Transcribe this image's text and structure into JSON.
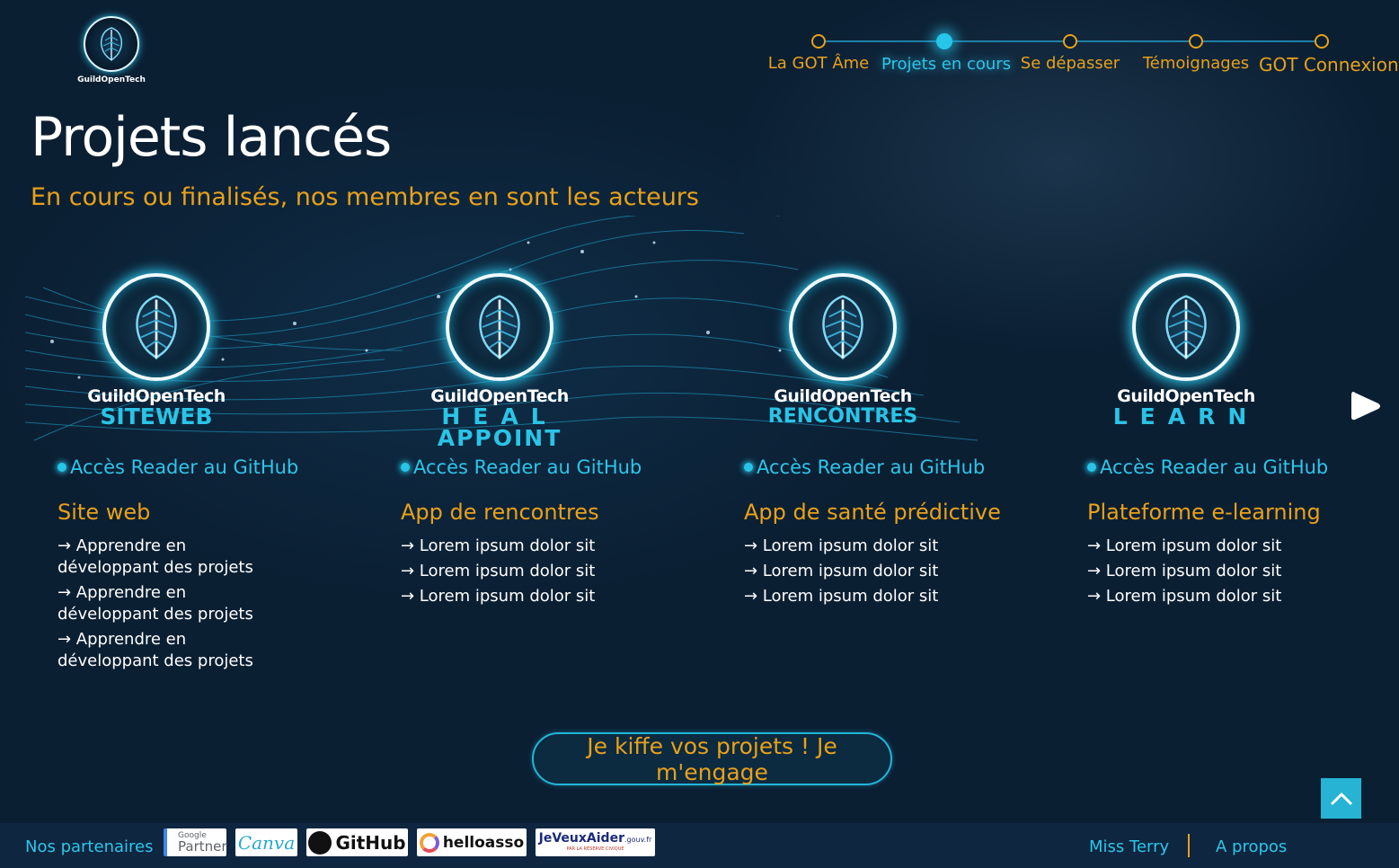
{
  "brand": {
    "logo_text": "GuildOpenTech",
    "logo_icon": "tree-brain-icon"
  },
  "nav": {
    "steps": [
      {
        "label": "La GOT Âme",
        "active": false
      },
      {
        "label": "Projets en cours",
        "active": true
      },
      {
        "label": "Se dépasser",
        "active": false
      },
      {
        "label": "Témoignages",
        "active": false
      },
      {
        "label": "GOT Connexion",
        "active": false
      }
    ]
  },
  "hero": {
    "title": "Projets lancés",
    "subtitle": "En cours ou finalisés, nos membres en sont les acteurs"
  },
  "projects": [
    {
      "brand": "GuildOpenTech",
      "sub_lines": [
        "SITEWEB"
      ],
      "github": "Accès Reader au GitHub",
      "title": "Site web",
      "items": [
        "→ Apprendre en développant des projets",
        "→ Apprendre en développant des projets",
        "→ Apprendre en développant des projets"
      ]
    },
    {
      "brand": "GuildOpenTech",
      "sub_lines": [
        "HEAL",
        "APPOINT"
      ],
      "github": "Accès Reader au GitHub",
      "title": "App de rencontres",
      "items": [
        "→ Lorem ipsum dolor sit",
        "→ Lorem ipsum dolor sit",
        "→ Lorem ipsum dolor sit"
      ]
    },
    {
      "brand": "GuildOpenTech",
      "sub_lines": [
        "RENCONTRES"
      ],
      "github": "Accès Reader au GitHub",
      "title": "App de santé prédictive",
      "items": [
        "→ Lorem ipsum dolor sit",
        "→ Lorem ipsum dolor sit",
        "→ Lorem ipsum dolor sit"
      ]
    },
    {
      "brand": "GuildOpenTech",
      "sub_lines": [
        "LEARN"
      ],
      "github": "Accès Reader au GitHub",
      "title": "Plateforme e-learning",
      "items": [
        "→ Lorem ipsum dolor sit",
        "→ Lorem ipsum dolor sit",
        "→ Lorem ipsum dolor sit"
      ]
    }
  ],
  "carousel": {
    "next_icon": "play-next-icon"
  },
  "cta": {
    "label": "Je kiffe vos projets ! Je m'engage"
  },
  "back_to_top": {
    "icon": "chevron-up-icon"
  },
  "footer": {
    "partners_label": "Nos partenaires",
    "partners": [
      {
        "name": "Google Partner",
        "top": "Google",
        "bottom": "Partner"
      },
      {
        "name": "Canva",
        "text": "Canva"
      },
      {
        "name": "GitHub",
        "text": "GitHub"
      },
      {
        "name": "helloasso",
        "text": "helloasso"
      },
      {
        "name": "JeVeuxAider.gouv.fr",
        "text": "JeVeuxAider",
        "suffix": ".gouv.fr",
        "tagline": "PAR LA RÉSERVE CIVIQUE"
      }
    ],
    "links": [
      "Miss Terry",
      "A propos"
    ]
  },
  "colors": {
    "background": "#0b1f33",
    "accent_orange": "#e8a11a",
    "accent_cyan": "#2ec5ea"
  }
}
